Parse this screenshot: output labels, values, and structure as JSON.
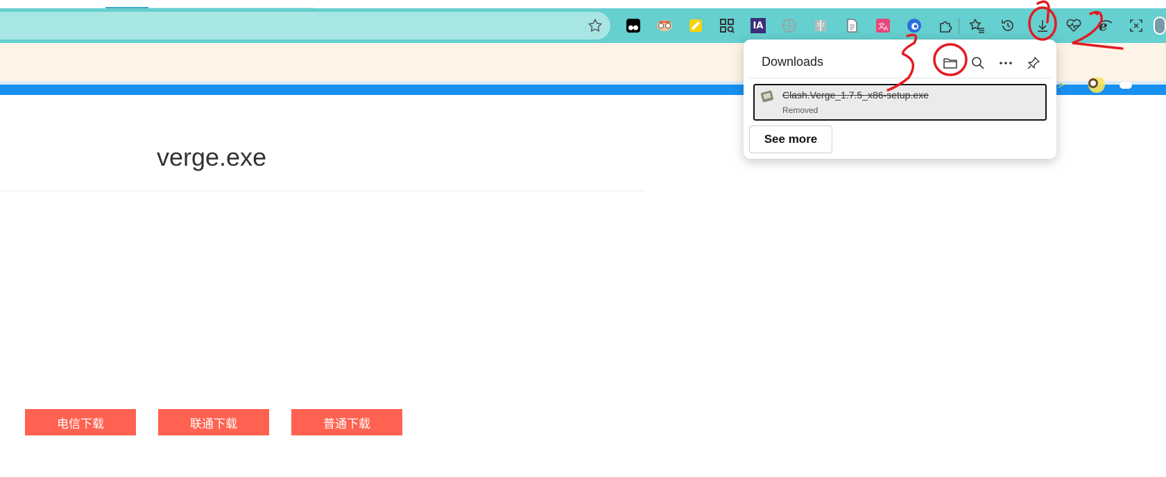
{
  "toolbar": {
    "favorite_icon": "star-outline-icon",
    "extensions": [
      {
        "name": "tampermonkey-icon",
        "color": "#000000"
      },
      {
        "name": "mask-icon",
        "color": "#e07050"
      },
      {
        "name": "sticky-note-icon",
        "color": "#f5d400"
      },
      {
        "name": "qr-code-icon",
        "color": "#333333"
      },
      {
        "name": "ia-icon",
        "color": "#3c2e7a",
        "text": "IA"
      },
      {
        "name": "globe-icon",
        "color": "#9aa5a5"
      },
      {
        "name": "reader-icon",
        "color": "#9aa5a5"
      },
      {
        "name": "document-icon",
        "color": "#777777"
      },
      {
        "name": "translate-icon",
        "color": "#e8467c"
      },
      {
        "name": "edge-ext-icon",
        "color": "#2a6fdc"
      },
      {
        "name": "extensions-puzzle-icon",
        "color": "#333333"
      },
      {
        "name": "favorites-icon",
        "color": "#333333"
      },
      {
        "name": "history-icon",
        "color": "#333333"
      },
      {
        "name": "download-icon",
        "color": "#333333"
      },
      {
        "name": "health-icon",
        "color": "#333333"
      },
      {
        "name": "ie-mode-icon",
        "color": "#333333"
      },
      {
        "name": "screenshot-icon",
        "color": "#333333"
      },
      {
        "name": "profile-avatar-icon",
        "color": "#7a9aa8"
      }
    ]
  },
  "page": {
    "title": "verge.exe",
    "buttons": [
      "电信下载",
      "联通下载",
      "普通下载"
    ]
  },
  "downloads": {
    "title": "Downloads",
    "actions": [
      "open-folder-icon",
      "search-icon",
      "more-icon",
      "pin-icon"
    ],
    "items": [
      {
        "filename": "Clash.Verge_1.7.5_x86-setup.exe",
        "status": "Removed",
        "icon": "file-exe-icon"
      }
    ],
    "see_more": "See more"
  },
  "annotations": {
    "color": "#e31b23",
    "labels": [
      "1",
      "2",
      "3"
    ]
  }
}
